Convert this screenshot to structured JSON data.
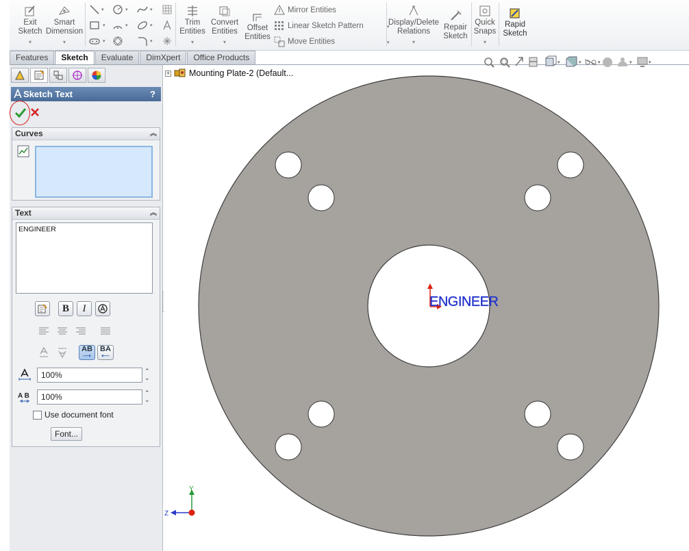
{
  "ribbon": {
    "exit_sketch": [
      "Exit",
      "Sketch"
    ],
    "smart_dimension": [
      "Smart",
      "Dimension"
    ],
    "trim_entities": [
      "Trim",
      "Entities"
    ],
    "convert_entities": [
      "Convert",
      "Entities"
    ],
    "offset_entities": [
      "Offset",
      "Entities"
    ],
    "mirror_entities": "Mirror Entities",
    "linear_sketch_pattern": "Linear Sketch Pattern",
    "move_entities": "Move Entities",
    "display_delete_relations": [
      "Display/Delete",
      "Relations"
    ],
    "repair_sketch": [
      "Repair",
      "Sketch"
    ],
    "quick_snaps": [
      "Quick",
      "Snaps"
    ],
    "rapid_sketch": [
      "Rapid",
      "Sketch"
    ]
  },
  "tabs": [
    {
      "label": "Features",
      "active": false
    },
    {
      "label": "Sketch",
      "active": true
    },
    {
      "label": "Evaluate",
      "active": false
    },
    {
      "label": "DimXpert",
      "active": false
    },
    {
      "label": "Office Products",
      "active": false
    }
  ],
  "property_manager": {
    "title": "Sketch Text",
    "help": "?",
    "curves_header": "Curves",
    "text_header": "Text",
    "text_value": "ENGINEER",
    "bold_label": "B",
    "italic_label": "I",
    "flip_vertical_label": "AB",
    "flip_horizontal_label": "BA",
    "width_factor": "100%",
    "spacing": "100%",
    "use_document_font_label": "Use document font",
    "use_document_font_checked": false,
    "font_button_label": "Font..."
  },
  "graphics": {
    "tree_label": "Mounting Plate-2  (Default...",
    "sketch_text": "ENGINEER",
    "part_color": "#a6a29e",
    "text_color": "#2233cc",
    "axis_y_label": "Y",
    "axis_z_label": "Z"
  }
}
